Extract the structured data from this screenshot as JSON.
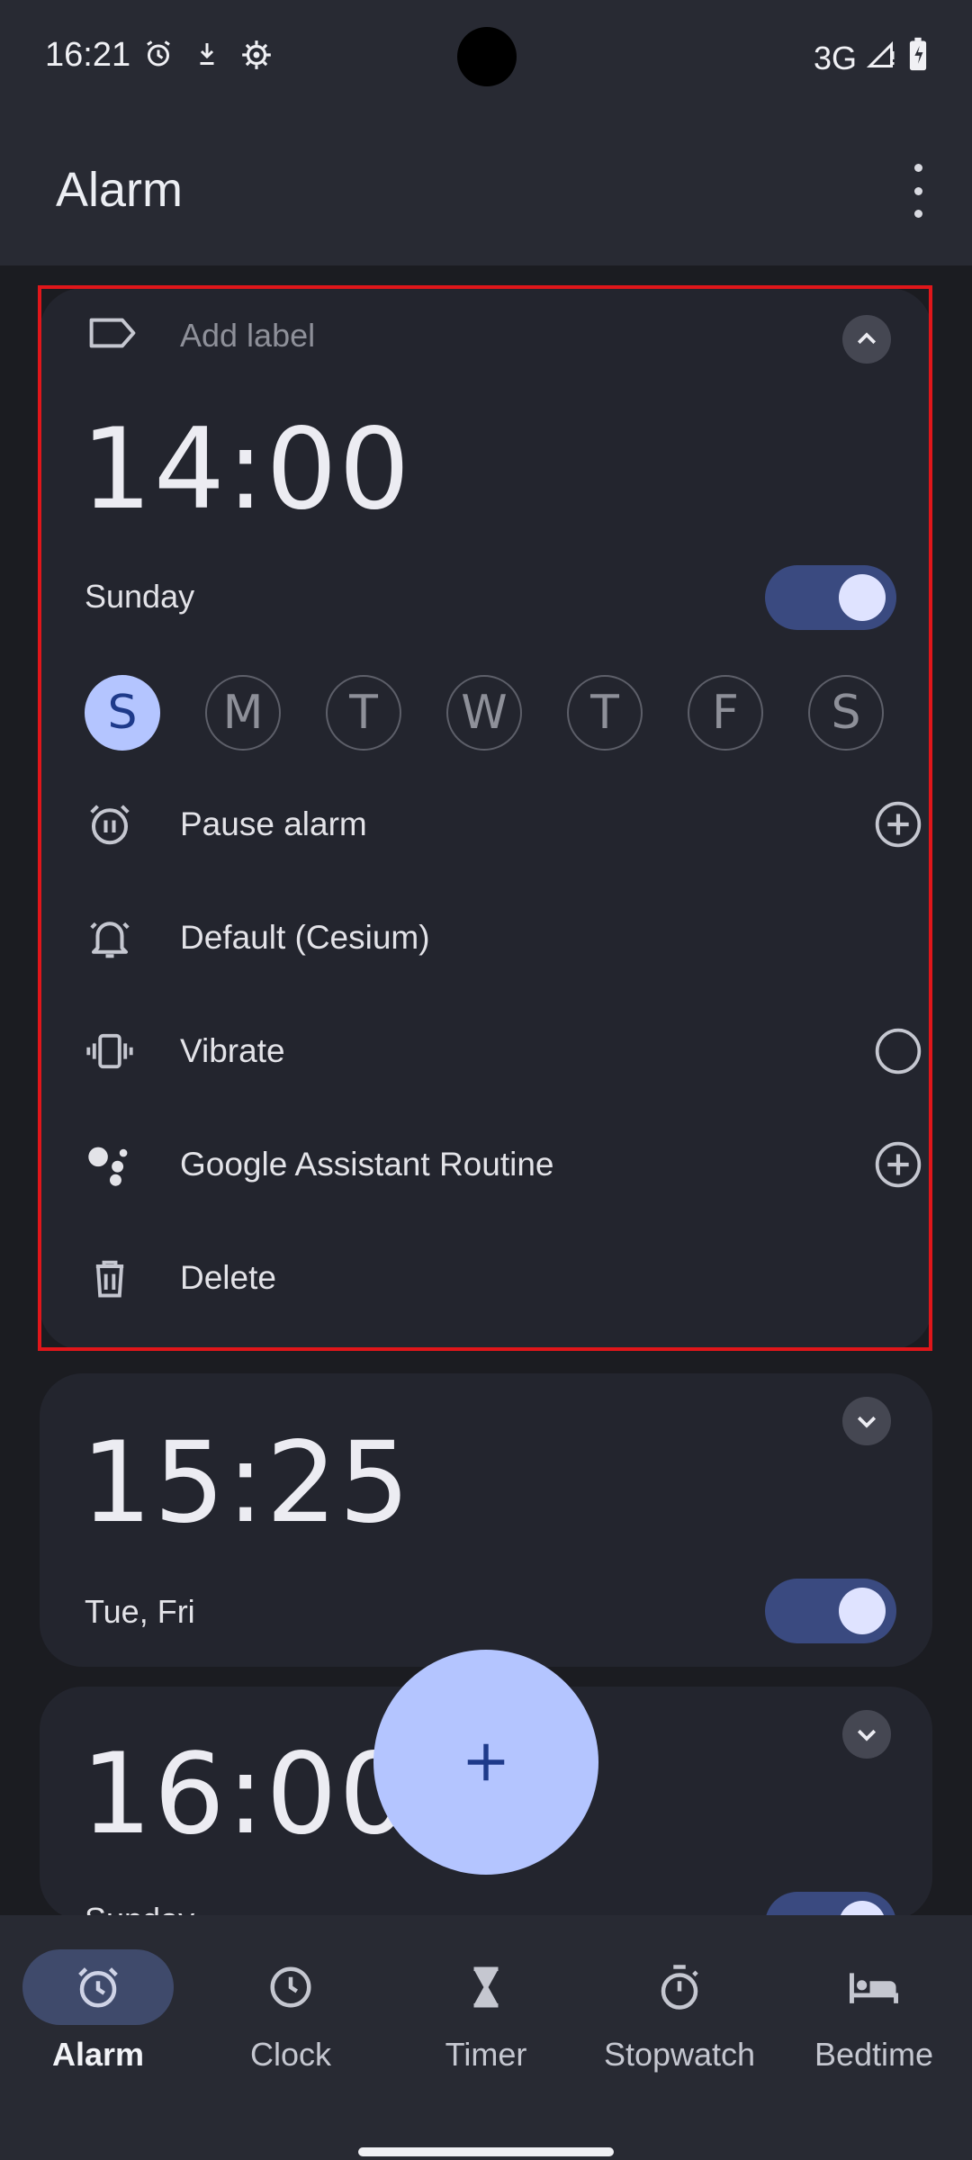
{
  "status_bar": {
    "time": "16:21",
    "network": "3G"
  },
  "app_bar": {
    "title": "Alarm"
  },
  "alarms": [
    {
      "label_placeholder": "Add label",
      "time": "14:00",
      "repeat": "Sunday",
      "enabled": true,
      "days": [
        {
          "letter": "S",
          "active": true
        },
        {
          "letter": "M",
          "active": false
        },
        {
          "letter": "T",
          "active": false
        },
        {
          "letter": "W",
          "active": false
        },
        {
          "letter": "T",
          "active": false
        },
        {
          "letter": "F",
          "active": false
        },
        {
          "letter": "S",
          "active": false
        }
      ],
      "options": {
        "pause": "Pause alarm",
        "sound": "Default (Cesium)",
        "vibrate": "Vibrate",
        "assistant": "Google Assistant Routine",
        "delete": "Delete"
      }
    },
    {
      "time": "15:25",
      "repeat": "Tue, Fri",
      "enabled": true
    },
    {
      "time": "16:00",
      "repeat": "Sunday",
      "enabled": true
    }
  ],
  "fab": {
    "icon": "plus-icon"
  },
  "bottom_nav": [
    {
      "label": "Alarm",
      "icon": "alarm-icon",
      "active": true
    },
    {
      "label": "Clock",
      "icon": "clock-icon",
      "active": false
    },
    {
      "label": "Timer",
      "icon": "hourglass-icon",
      "active": false
    },
    {
      "label": "Stopwatch",
      "icon": "stopwatch-icon",
      "active": false
    },
    {
      "label": "Bedtime",
      "icon": "bed-icon",
      "active": false
    }
  ],
  "colors": {
    "background": "#1b1c21",
    "surface": "#23252e",
    "bar": "#282a33",
    "accent": "#b4c5ff",
    "toggle_track": "#3a4a80",
    "highlight_border": "#e0161a"
  }
}
